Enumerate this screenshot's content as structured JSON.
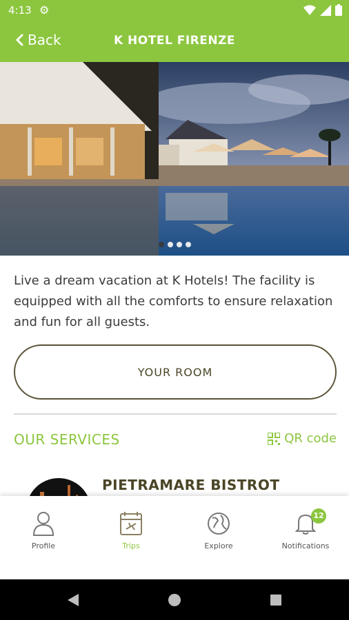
{
  "status_bar": {
    "time": "4:13"
  },
  "app_bar": {
    "back_label": "Back",
    "title": "K HOTEL FIRENZE"
  },
  "carousel": {
    "total": 4,
    "active_index": 0
  },
  "description": "Live a dream vacation at K Hotels! The facility is equipped with all the comforts to ensure relaxation and fun for all guests.",
  "room_button": "YOUR ROOM",
  "services": {
    "title": "OUR SERVICES",
    "qr_label": "QR code",
    "first_item": "PIETRAMARE BISTROT"
  },
  "bottom_nav": [
    {
      "label": "Profile",
      "icon": "person-icon",
      "active": false
    },
    {
      "label": "Trips",
      "icon": "calendar-plane-icon",
      "active": true
    },
    {
      "label": "Explore",
      "icon": "globe-icon",
      "active": false
    },
    {
      "label": "Notifications",
      "icon": "bell-icon",
      "active": false,
      "badge": "12"
    }
  ],
  "colors": {
    "brand": "#8cc63f",
    "text_dark": "#4a4526",
    "body_text": "#3b3b3b"
  }
}
